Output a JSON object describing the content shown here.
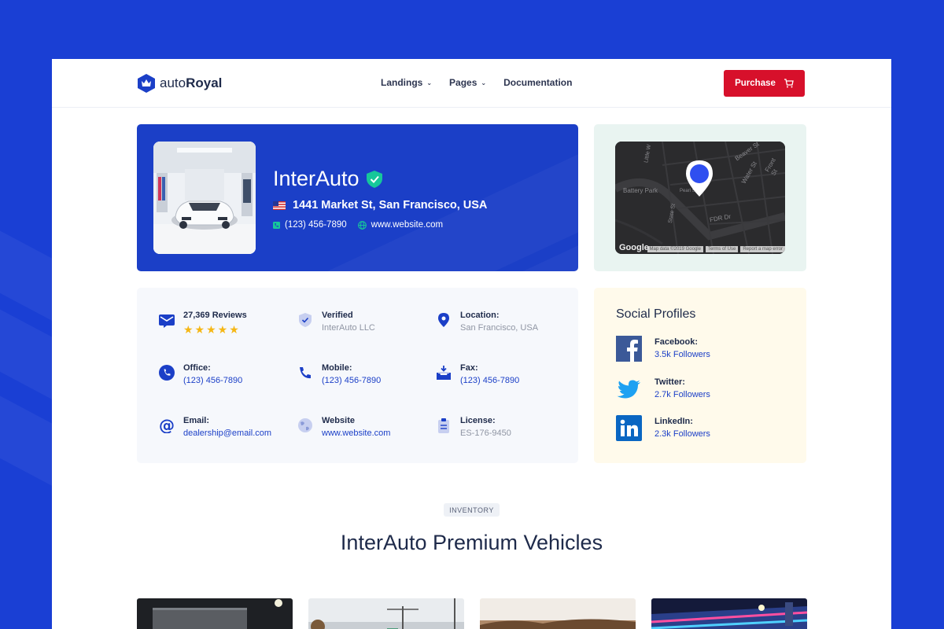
{
  "nav": {
    "logo_light": "auto",
    "logo_bold": "Royal",
    "links": [
      "Landings",
      "Pages",
      "Documentation"
    ],
    "purchase_label": "Purchase"
  },
  "dealer": {
    "name": "InterAuto",
    "address": "1441 Market St, San Francisco, USA",
    "phone": "(123) 456-7890",
    "website": "www.website.com"
  },
  "map": {
    "labels": [
      "Battery Park",
      "FDR Dr",
      "Water St",
      "Front St",
      "Beaver St",
      "Pearl St",
      "State St",
      "Little W"
    ],
    "footer": [
      "Map data ©2019 Google",
      "Terms of Use",
      "Report a map error"
    ],
    "brand": "Google"
  },
  "info": {
    "reviews": {
      "label": "27,369 Reviews",
      "stars": "★★★★★",
      "rating": 5
    },
    "verified": {
      "label": "Verified",
      "value": "InterAuto LLC"
    },
    "location": {
      "label": "Location:",
      "value": "San Francisco, USA"
    },
    "office": {
      "label": "Office:",
      "value": "(123) 456-7890"
    },
    "mobile": {
      "label": "Mobile:",
      "value": "(123) 456-7890"
    },
    "fax": {
      "label": "Fax:",
      "value": "(123) 456-7890"
    },
    "email": {
      "label": "Email:",
      "value": "dealership@email.com"
    },
    "website": {
      "label": "Website",
      "value": "www.website.com"
    },
    "license": {
      "label": "License:",
      "value": "ES-176-9450"
    }
  },
  "social": {
    "title": "Social Profiles",
    "items": [
      {
        "name": "Facebook:",
        "followers": "3.5k Followers",
        "icon": "facebook-icon",
        "color": "#3b5998"
      },
      {
        "name": "Twitter:",
        "followers": "2.7k Followers",
        "icon": "twitter-icon",
        "color": "#1da1f2"
      },
      {
        "name": "LinkedIn:",
        "followers": "2.3k Followers",
        "icon": "linkedin-icon",
        "color": "#0a66c2"
      }
    ]
  },
  "inventory": {
    "badge": "INVENTORY",
    "title": "InterAuto Premium Vehicles"
  },
  "colors": {
    "brand_blue": "#1b3fc7",
    "page_bg": "#1a3fd4",
    "purchase_red": "#d7102b",
    "verified_green": "#16c79a",
    "star_yellow": "#f5b715"
  }
}
